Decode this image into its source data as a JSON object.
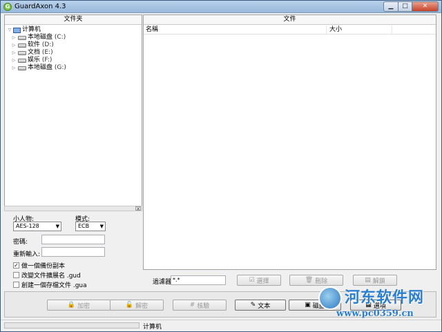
{
  "window": {
    "title": "GuardAxon 4.3",
    "app_icon": "G"
  },
  "colors": {
    "accent": "#98b8dc",
    "close": "#c7432a",
    "watermark": "#2b7fd0"
  },
  "folder_pane": {
    "header": "文件夹",
    "root": "计算机",
    "drives": [
      {
        "label": "本地磁盘",
        "letter": "(C:)"
      },
      {
        "label": "软件",
        "letter": "(D:)"
      },
      {
        "label": "文档",
        "letter": "(E:)"
      },
      {
        "label": "娱乐",
        "letter": "(F:)"
      },
      {
        "label": "本地磁盘",
        "letter": "(G:)"
      }
    ]
  },
  "settings": {
    "cipher_label": "小人物:",
    "cipher_value": "AES-128",
    "mode_label": "模式:",
    "mode_value": "ECB",
    "password_label": "密碼:",
    "reenter_label": "重新輸入:",
    "checkboxes": [
      {
        "label": "做一個備份副本",
        "checked": true
      },
      {
        "label": "改變文件擴展名 .gud",
        "checked": false
      },
      {
        "label": "創建一個存檔文件 .gua",
        "checked": false
      }
    ]
  },
  "file_pane": {
    "header": "文件",
    "columns": {
      "name": "名稱",
      "size": "大小"
    }
  },
  "filter_bar": {
    "filter_label": "過濾器:",
    "filter_value": "*.*",
    "select_label": "選擇",
    "delete_label": "刪除",
    "unlock_label": "解鎖"
  },
  "actions": {
    "encrypt_label": "加密",
    "decrypt_label": "解密",
    "check_label": "核驗",
    "text_label": "文本",
    "disk_label": "磁盘",
    "options_label": "選項"
  },
  "status": {
    "text": "计算机"
  },
  "watermark": {
    "main": "河东软件网",
    "url": "www.pc0359.cn"
  }
}
